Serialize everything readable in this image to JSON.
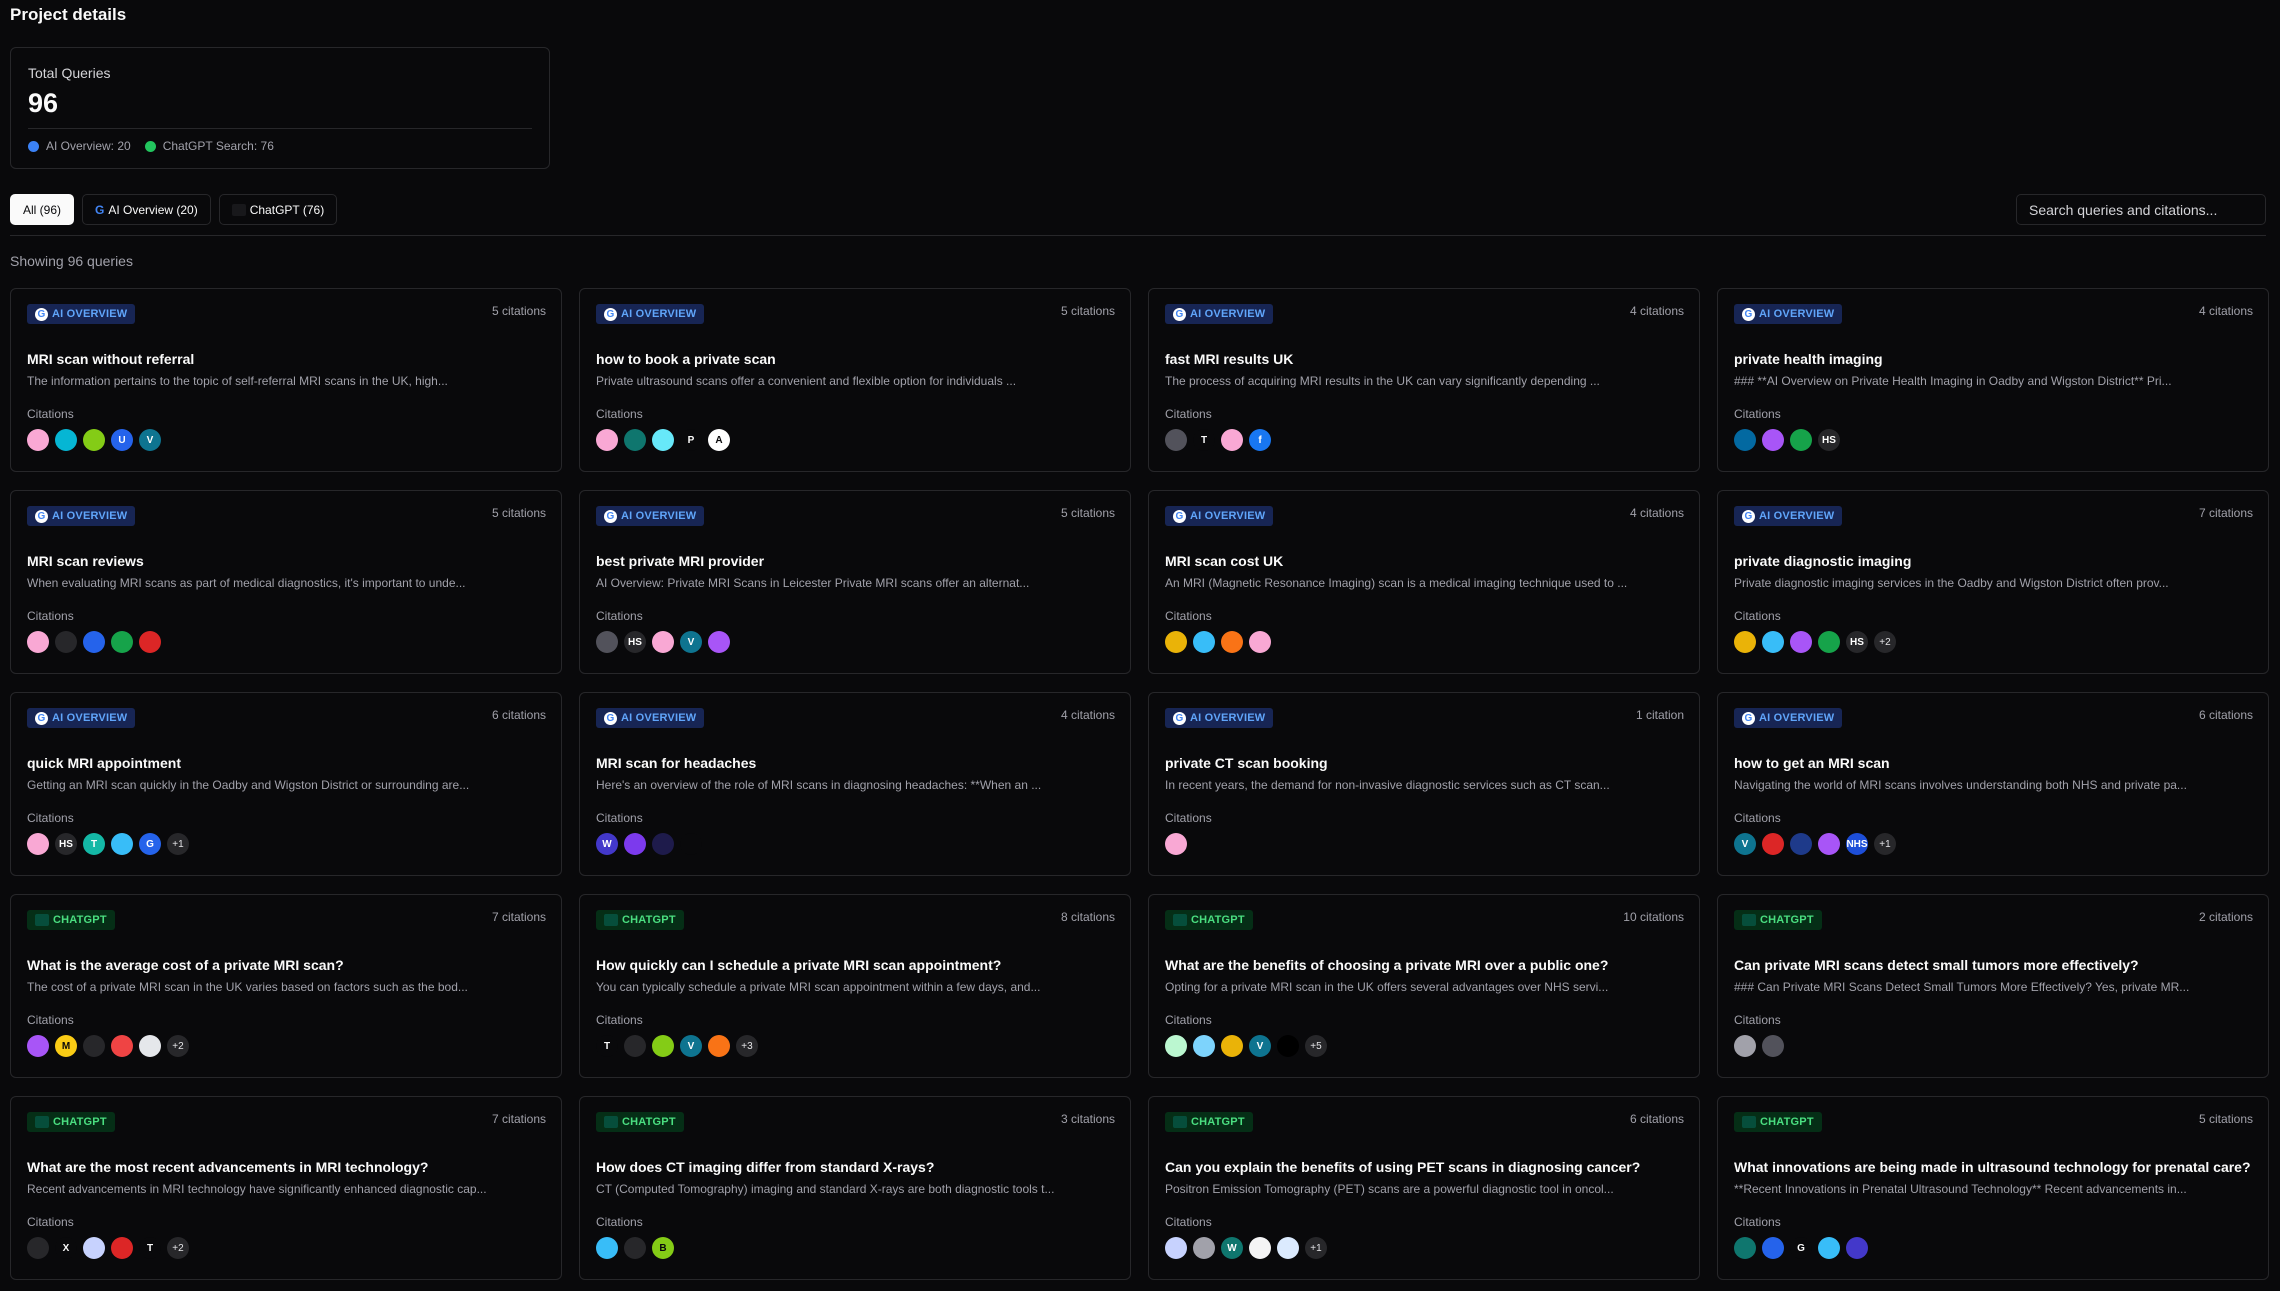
{
  "page": {
    "title": "Project details"
  },
  "stats": {
    "label": "Total Queries",
    "value": "96",
    "legend": [
      {
        "label": "AI Overview: 20",
        "color": "#3b82f6"
      },
      {
        "label": "ChatGPT Search: 76",
        "color": "#22c55e"
      }
    ]
  },
  "filters": {
    "tabs": [
      {
        "label": "All (96)",
        "active": true,
        "icon": ""
      },
      {
        "label": "AI Overview (20)",
        "active": false,
        "icon": "google-icon"
      },
      {
        "label": "ChatGPT (76)",
        "active": false,
        "icon": "chatgpt-icon"
      }
    ]
  },
  "search": {
    "placeholder": "Search queries and citations..."
  },
  "list": {
    "showing": "Showing 96 queries",
    "citations_label": "Citations"
  },
  "badges": {
    "ai": "AI OVERVIEW",
    "gpt": "CHATGPT"
  },
  "cards": [
    {
      "type": "ai",
      "citations": "5 citations",
      "title": "MRI scan without referral",
      "desc": "The information pertains to the topic of self-referral MRI scans in the UK, high...",
      "favicons": [
        {
          "c": "#f9a8d4",
          "t": ""
        },
        {
          "c": "#06b6d4",
          "t": ""
        },
        {
          "c": "#84cc16",
          "t": ""
        },
        {
          "c": "#2563eb",
          "t": "U"
        },
        {
          "c": "#0e7490",
          "t": "V"
        }
      ],
      "more": ""
    },
    {
      "type": "ai",
      "citations": "5 citations",
      "title": "how to book a private scan",
      "desc": "Private ultrasound scans offer a convenient and flexible option for individuals ...",
      "favicons": [
        {
          "c": "#f9a8d4",
          "t": ""
        },
        {
          "c": "#0f766e",
          "t": ""
        },
        {
          "c": "#67e8f9",
          "t": ""
        },
        {
          "c": "#09090b",
          "t": "P"
        },
        {
          "c": "#ffffff",
          "t": "A"
        }
      ],
      "more": ""
    },
    {
      "type": "ai",
      "citations": "4 citations",
      "title": "fast MRI results UK",
      "desc": "The process of acquiring MRI results in the UK can vary significantly depending ...",
      "favicons": [
        {
          "c": "#52525b",
          "t": ""
        },
        {
          "c": "#09090b",
          "t": "T"
        },
        {
          "c": "#f9a8d4",
          "t": ""
        },
        {
          "c": "#1877f2",
          "t": "f"
        }
      ],
      "more": ""
    },
    {
      "type": "ai",
      "citations": "4 citations",
      "title": "private health imaging",
      "desc": "### **AI Overview on Private Health Imaging in Oadby and Wigston District** Pri...",
      "favicons": [
        {
          "c": "#0369a1",
          "t": ""
        },
        {
          "c": "#a855f7",
          "t": ""
        },
        {
          "c": "#16a34a",
          "t": ""
        },
        {
          "c": "#27272a",
          "t": "HS"
        }
      ],
      "more": ""
    },
    {
      "type": "ai",
      "citations": "5 citations",
      "title": "MRI scan reviews",
      "desc": "When evaluating MRI scans as part of medical diagnostics, it's important to unde...",
      "favicons": [
        {
          "c": "#f9a8d4",
          "t": ""
        },
        {
          "c": "#27272a",
          "t": ""
        },
        {
          "c": "#2563eb",
          "t": ""
        },
        {
          "c": "#16a34a",
          "t": ""
        },
        {
          "c": "#dc2626",
          "t": ""
        }
      ],
      "more": ""
    },
    {
      "type": "ai",
      "citations": "5 citations",
      "title": "best private MRI provider",
      "desc": "AI Overview: Private MRI Scans in Leicester Private MRI scans offer an alternat...",
      "favicons": [
        {
          "c": "#52525b",
          "t": ""
        },
        {
          "c": "#27272a",
          "t": "HS"
        },
        {
          "c": "#f9a8d4",
          "t": ""
        },
        {
          "c": "#0e7490",
          "t": "V"
        },
        {
          "c": "#a855f7",
          "t": ""
        }
      ],
      "more": ""
    },
    {
      "type": "ai",
      "citations": "4 citations",
      "title": "MRI scan cost UK",
      "desc": "An MRI (Magnetic Resonance Imaging) scan is a medical imaging technique used to ...",
      "favicons": [
        {
          "c": "#eab308",
          "t": ""
        },
        {
          "c": "#38bdf8",
          "t": ""
        },
        {
          "c": "#f97316",
          "t": ""
        },
        {
          "c": "#f9a8d4",
          "t": ""
        }
      ],
      "more": ""
    },
    {
      "type": "ai",
      "citations": "7 citations",
      "title": "private diagnostic imaging",
      "desc": "Private diagnostic imaging services in the Oadby and Wigston District often prov...",
      "favicons": [
        {
          "c": "#eab308",
          "t": ""
        },
        {
          "c": "#38bdf8",
          "t": ""
        },
        {
          "c": "#a855f7",
          "t": ""
        },
        {
          "c": "#16a34a",
          "t": ""
        },
        {
          "c": "#27272a",
          "t": "HS"
        }
      ],
      "more": "+2"
    },
    {
      "type": "ai",
      "citations": "6 citations",
      "title": "quick MRI appointment",
      "desc": "Getting an MRI scan quickly in the Oadby and Wigston District or surrounding are...",
      "favicons": [
        {
          "c": "#f9a8d4",
          "t": ""
        },
        {
          "c": "#27272a",
          "t": "HS"
        },
        {
          "c": "#14b8a6",
          "t": "T"
        },
        {
          "c": "#38bdf8",
          "t": ""
        },
        {
          "c": "#2563eb",
          "t": "G"
        }
      ],
      "more": "+1"
    },
    {
      "type": "ai",
      "citations": "4 citations",
      "title": "MRI scan for headaches",
      "desc": "Here's an overview of the role of MRI scans in diagnosing headaches: **When an ...",
      "favicons": [
        {
          "c": "#4338ca",
          "t": "W"
        },
        {
          "c": "#7c3aed",
          "t": ""
        },
        {
          "c": "#1e1b4b",
          "t": ""
        },
        {
          "c": "#09090b",
          "t": ""
        }
      ],
      "more": ""
    },
    {
      "type": "ai",
      "citations": "1 citation",
      "title": "private CT scan booking",
      "desc": "In recent years, the demand for non-invasive diagnostic services such as CT scan...",
      "favicons": [
        {
          "c": "#f9a8d4",
          "t": ""
        }
      ],
      "more": ""
    },
    {
      "type": "ai",
      "citations": "6 citations",
      "title": "how to get an MRI scan",
      "desc": "Navigating the world of MRI scans involves understanding both NHS and private pa...",
      "favicons": [
        {
          "c": "#0e7490",
          "t": "V"
        },
        {
          "c": "#dc2626",
          "t": ""
        },
        {
          "c": "#1e3a8a",
          "t": ""
        },
        {
          "c": "#a855f7",
          "t": ""
        },
        {
          "c": "#1d4ed8",
          "t": "NHS"
        }
      ],
      "more": "+1"
    },
    {
      "type": "gpt",
      "citations": "7 citations",
      "title": "What is the average cost of a private MRI scan?",
      "desc": "The cost of a private MRI scan in the UK varies based on factors such as the bod...",
      "favicons": [
        {
          "c": "#a855f7",
          "t": ""
        },
        {
          "c": "#facc15",
          "t": "M"
        },
        {
          "c": "#27272a",
          "t": ""
        },
        {
          "c": "#ef4444",
          "t": ""
        },
        {
          "c": "#e5e7eb",
          "t": ""
        }
      ],
      "more": "+2"
    },
    {
      "type": "gpt",
      "citations": "8 citations",
      "title": "How quickly can I schedule a private MRI scan appointment?",
      "desc": "You can typically schedule a private MRI scan appointment within a few days, and...",
      "favicons": [
        {
          "c": "#09090b",
          "t": "T"
        },
        {
          "c": "#27272a",
          "t": ""
        },
        {
          "c": "#84cc16",
          "t": ""
        },
        {
          "c": "#0e7490",
          "t": "V"
        },
        {
          "c": "#f97316",
          "t": ""
        }
      ],
      "more": "+3"
    },
    {
      "type": "gpt",
      "citations": "10 citations",
      "title": "What are the benefits of choosing a private MRI over a public one?",
      "desc": "Opting for a private MRI scan in the UK offers several advantages over NHS servi...",
      "favicons": [
        {
          "c": "#bbf7d0",
          "t": ""
        },
        {
          "c": "#7dd3fc",
          "t": ""
        },
        {
          "c": "#eab308",
          "t": ""
        },
        {
          "c": "#0e7490",
          "t": "V"
        },
        {
          "c": "#000000",
          "t": ""
        }
      ],
      "more": "+5"
    },
    {
      "type": "gpt",
      "citations": "2 citations",
      "title": "Can private MRI scans detect small tumors more effectively?",
      "desc": "### Can Private MRI Scans Detect Small Tumors More Effectively? Yes, private MR...",
      "favicons": [
        {
          "c": "#a1a1aa",
          "t": ""
        },
        {
          "c": "#52525b",
          "t": ""
        }
      ],
      "more": ""
    },
    {
      "type": "gpt",
      "citations": "7 citations",
      "title": "What are the most recent advancements in MRI technology?",
      "desc": "Recent advancements in MRI technology have significantly enhanced diagnostic cap...",
      "favicons": [
        {
          "c": "#27272a",
          "t": ""
        },
        {
          "c": "#09090b",
          "t": "X"
        },
        {
          "c": "#c7d2fe",
          "t": ""
        },
        {
          "c": "#dc2626",
          "t": ""
        },
        {
          "c": "#09090b",
          "t": "T"
        }
      ],
      "more": "+2"
    },
    {
      "type": "gpt",
      "citations": "3 citations",
      "title": "How does CT imaging differ from standard X-rays?",
      "desc": "CT (Computed Tomography) imaging and standard X-rays are both diagnostic tools t...",
      "favicons": [
        {
          "c": "#38bdf8",
          "t": ""
        },
        {
          "c": "#27272a",
          "t": ""
        },
        {
          "c": "#84cc16",
          "t": "B"
        }
      ],
      "more": ""
    },
    {
      "type": "gpt",
      "citations": "6 citations",
      "title": "Can you explain the benefits of using PET scans in diagnosing cancer?",
      "desc": "Positron Emission Tomography (PET) scans are a powerful diagnostic tool in oncol...",
      "favicons": [
        {
          "c": "#c7d2fe",
          "t": ""
        },
        {
          "c": "#a1a1aa",
          "t": ""
        },
        {
          "c": "#0f766e",
          "t": "W"
        },
        {
          "c": "#f4f4f5",
          "t": ""
        },
        {
          "c": "#dbeafe",
          "t": ""
        }
      ],
      "more": "+1"
    },
    {
      "type": "gpt",
      "citations": "5 citations",
      "title": "What innovations are being made in ultrasound technology for prenatal care?",
      "desc": "**Recent Innovations in Prenatal Ultrasound Technology** Recent advancements in...",
      "favicons": [
        {
          "c": "#0f766e",
          "t": ""
        },
        {
          "c": "#2563eb",
          "t": ""
        },
        {
          "c": "#09090b",
          "t": "G"
        },
        {
          "c": "#38bdf8",
          "t": ""
        },
        {
          "c": "#4338ca",
          "t": ""
        }
      ],
      "more": ""
    }
  ]
}
